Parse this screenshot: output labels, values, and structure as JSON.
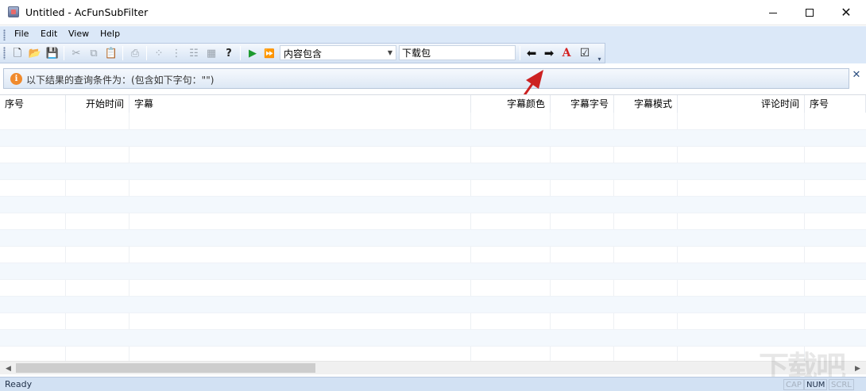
{
  "window": {
    "title": "Untitled - AcFunSubFilter",
    "minimize_icon": "minimize-icon",
    "maximize_icon": "maximize-icon",
    "close_icon": "close-icon",
    "close_glyph": "✕"
  },
  "menu": [
    {
      "label": "File"
    },
    {
      "label": "Edit"
    },
    {
      "label": "View"
    },
    {
      "label": "Help"
    }
  ],
  "toolbar": {
    "buttons": [
      {
        "name": "new-icon",
        "glyph": "🗋"
      },
      {
        "name": "open-icon",
        "glyph": "📂"
      },
      {
        "name": "save-icon",
        "glyph": "💾"
      },
      {
        "name": "cut-icon",
        "glyph": "✂"
      },
      {
        "name": "copy-icon",
        "glyph": "⧉"
      },
      {
        "name": "paste-icon",
        "glyph": "📋"
      },
      {
        "name": "print-icon",
        "glyph": "⎙"
      },
      {
        "name": "list-small-icon",
        "glyph": "⁘"
      },
      {
        "name": "list-tree-icon",
        "glyph": "⋮"
      },
      {
        "name": "list-detail-icon",
        "glyph": "☷"
      },
      {
        "name": "grid-icon",
        "glyph": "▦"
      },
      {
        "name": "help-icon",
        "glyph": "?"
      },
      {
        "name": "play-icon",
        "glyph": "▶"
      },
      {
        "name": "fast-forward-icon",
        "glyph": "⏩"
      },
      {
        "name": "arrow-left-icon",
        "glyph": "⬅"
      },
      {
        "name": "arrow-right-icon",
        "glyph": "➡"
      },
      {
        "name": "font-color-icon",
        "glyph": "A"
      },
      {
        "name": "checkbox-icon",
        "glyph": "☑"
      }
    ],
    "filter_mode": {
      "selected": "内容包含",
      "arrow": "▼"
    },
    "search": {
      "value": "下载包"
    },
    "overflow_glyph": "▾"
  },
  "infobar": {
    "icon": "info-icon",
    "icon_glyph": "i",
    "text": "以下结果的查询条件为：(包含如下字句：\"\")",
    "close_glyph": "✕"
  },
  "table": {
    "columns": [
      {
        "label": "序号"
      },
      {
        "label": "开始时间"
      },
      {
        "label": "字幕"
      },
      {
        "label": "字幕颜色"
      },
      {
        "label": "字幕字号"
      },
      {
        "label": "字幕模式"
      },
      {
        "label": "评论时间"
      },
      {
        "label": "序号"
      }
    ],
    "rows": []
  },
  "scrollbar": {
    "left_glyph": "◀",
    "right_glyph": "▶"
  },
  "status": {
    "text": "Ready",
    "indicators": [
      {
        "label": "CAP",
        "active": false
      },
      {
        "label": "NUM",
        "active": true
      },
      {
        "label": "SCRL",
        "active": false
      }
    ]
  },
  "watermark": {
    "text": "下载吧"
  },
  "colors": {
    "annotation_arrow": "#cc2222",
    "toolbar_bg": "#dbe8f8",
    "row_alt": "#f3f8fd",
    "info_icon": "#f08a2c"
  }
}
